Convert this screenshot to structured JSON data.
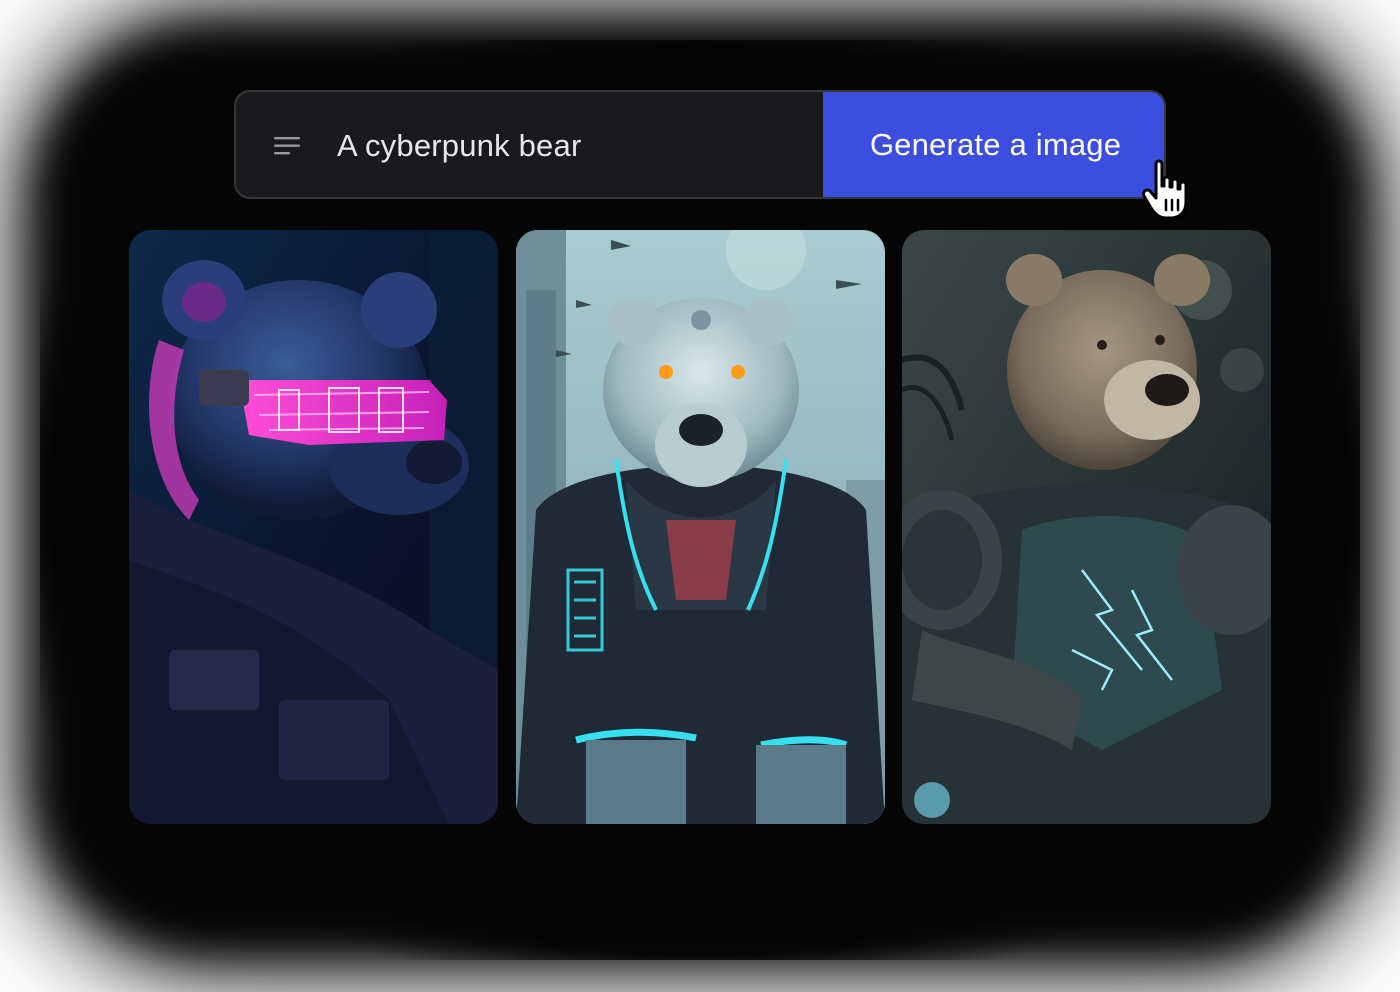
{
  "prompt": {
    "menu_icon": "menu-lines-icon",
    "value": "A cyberpunk bear"
  },
  "generate_button": {
    "label": "Generate a image",
    "color": "#3b4ee0"
  },
  "cursor": {
    "icon": "hand-pointer-icon"
  },
  "results": [
    {
      "subject": "bear with neon visor",
      "palette": [
        "#0b1530",
        "#e040c8",
        "#2a3f7a"
      ]
    },
    {
      "subject": "polar bear in jacket",
      "palette": [
        "#9fc4cc",
        "#1f2a36",
        "#36e0f0"
      ]
    },
    {
      "subject": "armored brown bear",
      "palette": [
        "#2a3636",
        "#8a7a68",
        "#7ce0ff"
      ]
    }
  ]
}
